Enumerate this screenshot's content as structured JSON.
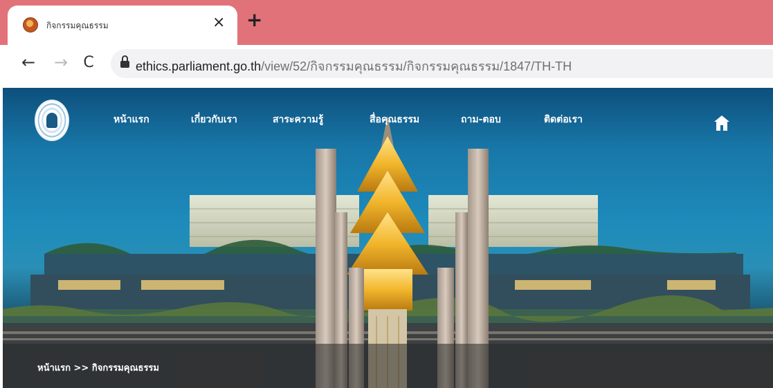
{
  "browser": {
    "tab": {
      "title": "กิจกรรมคุณธรรม",
      "close_glyph": "×",
      "favicon": "parliament-favicon"
    },
    "new_tab_glyph": "+",
    "nav": {
      "back_glyph": "←",
      "forward_glyph": "→",
      "reload_glyph": "C"
    },
    "address": {
      "host": "ethics.parliament.go.th",
      "path": "/view/52/กิจกรรมคุณธรรม/กิจกรรมคุณธรรม/1847/TH-TH",
      "lock_icon": "lock-icon"
    },
    "colors": {
      "tabstrip": "#e1727a",
      "omnibox": "#f2f2f4"
    }
  },
  "site": {
    "logo_icon": "parliament-seal",
    "menu": [
      {
        "label": "หน้าแรก"
      },
      {
        "label": "เกี่ยวกับเรา"
      },
      {
        "label": "สาระความรู้"
      },
      {
        "label": "สื่อคุณธรรม"
      },
      {
        "label": "ถาม-ตอบ"
      },
      {
        "label": "ติดต่อเรา"
      }
    ],
    "home_icon": "home-icon",
    "breadcrumb": {
      "home": "หน้าแรก",
      "separator": ">>",
      "current": "กิจกรรมคุณธรรม"
    },
    "colors": {
      "sky": "#1d8bbb",
      "spire_gold": "#f2b62c"
    }
  }
}
